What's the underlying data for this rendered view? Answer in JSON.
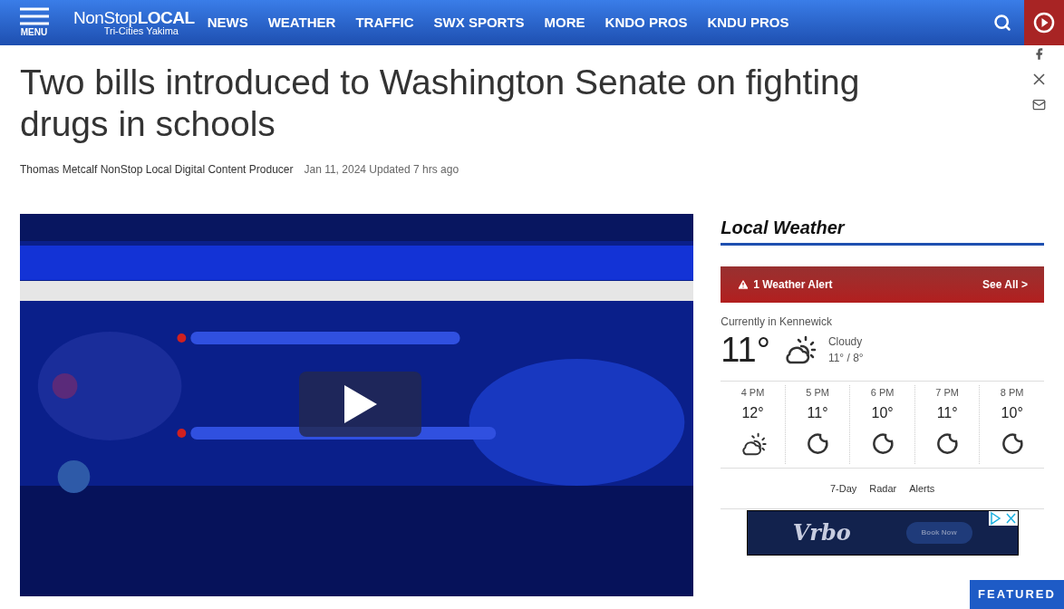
{
  "header": {
    "menu_label": "MENU",
    "logo": {
      "main": "NonStop",
      "accent": "LOCAL",
      "sub_1": "Tri-Cities",
      "sub_2": "Yakima"
    },
    "nav": [
      "NEWS",
      "WEATHER",
      "TRAFFIC",
      "SWX SPORTS",
      "MORE",
      "KNDO PROS",
      "KNDU PROS"
    ]
  },
  "article": {
    "title": "Two bills introduced to Washington Senate on fighting drugs in schools",
    "author": "Thomas Metcalf NonStop Local Digital Content Producer",
    "date": "Jan 11, 2024",
    "updated": "Updated 7 hrs ago"
  },
  "weather": {
    "heading": "Local Weather",
    "alert": "1 Weather Alert",
    "see_all": "See All >",
    "location": "Currently in Kennewick",
    "temp": "11°",
    "condition": "Cloudy",
    "hi_lo": "11° / 8°",
    "kind": "partly-cloudy",
    "hourly": [
      {
        "time": "4 PM",
        "temp": "12°",
        "kind": "partly-cloudy"
      },
      {
        "time": "5 PM",
        "temp": "11°",
        "kind": "moon"
      },
      {
        "time": "6 PM",
        "temp": "10°",
        "kind": "moon"
      },
      {
        "time": "7 PM",
        "temp": "11°",
        "kind": "moon"
      },
      {
        "time": "8 PM",
        "temp": "10°",
        "kind": "moon"
      }
    ],
    "links": [
      "7-Day",
      "Radar",
      "Alerts"
    ]
  },
  "ad": {
    "brand": "Vrbo",
    "cta": "Book Now"
  },
  "featured": "FEATURED"
}
